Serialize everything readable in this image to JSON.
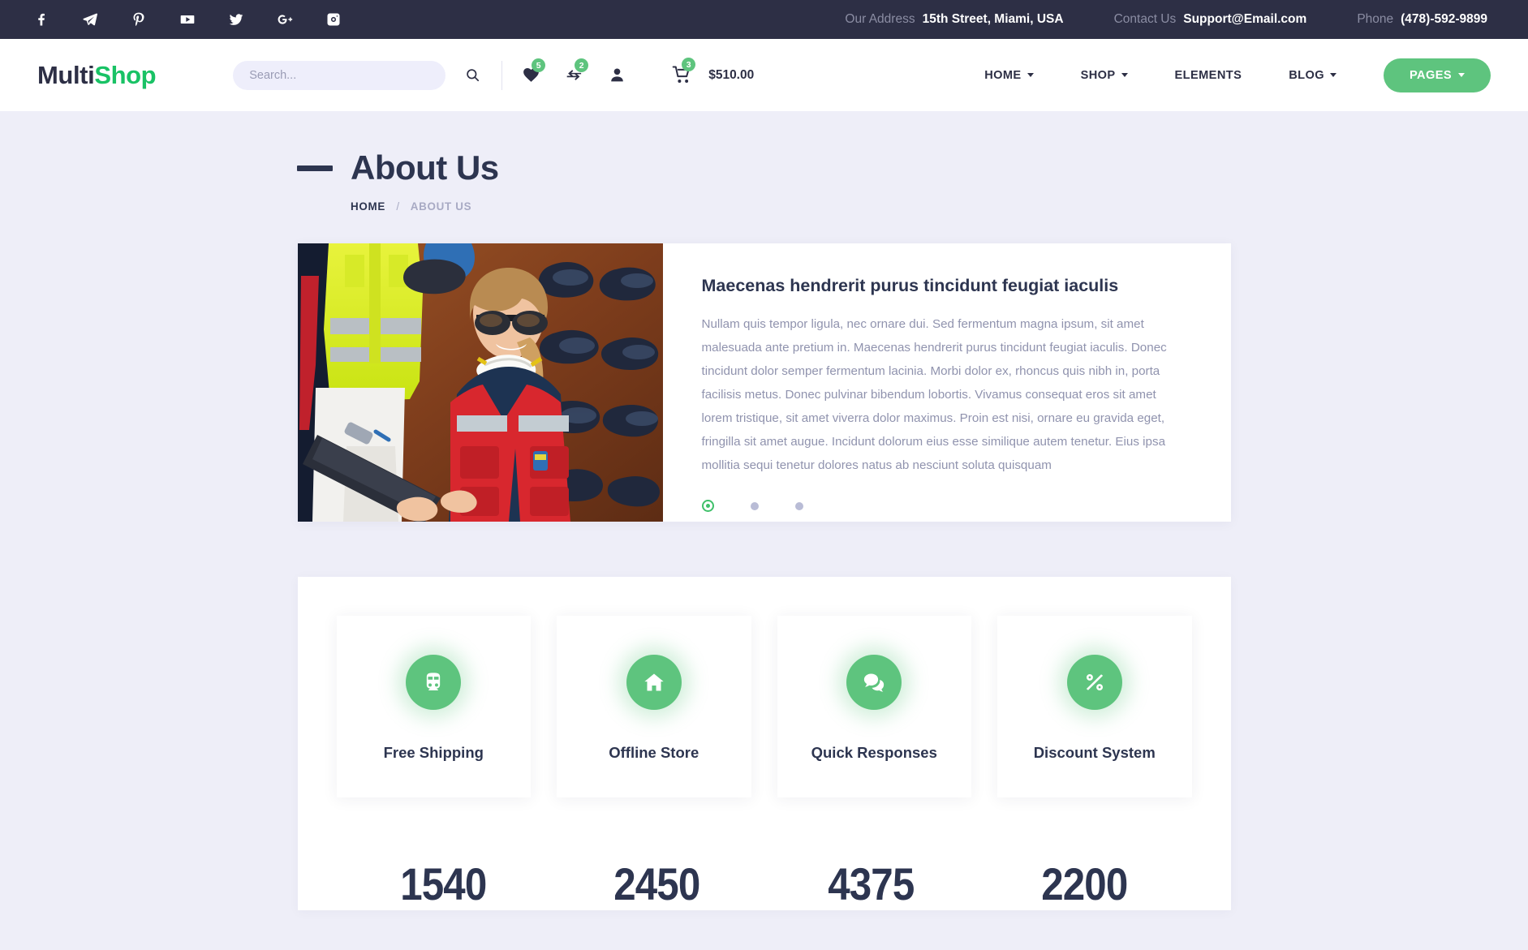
{
  "topbar": {
    "social": [
      {
        "name": "facebook-icon",
        "label": "Facebook"
      },
      {
        "name": "telegram-icon",
        "label": "Telegram"
      },
      {
        "name": "pinterest-icon",
        "label": "Pinterest"
      },
      {
        "name": "youtube-icon",
        "label": "YouTube"
      },
      {
        "name": "twitter-icon",
        "label": "Twitter"
      },
      {
        "name": "google-plus-icon",
        "label": "Google Plus"
      },
      {
        "name": "instagram-icon",
        "label": "Instagram"
      }
    ],
    "address_label": "Our Address",
    "address_value": "15th Street, Miami, USA",
    "contact_label": "Contact Us",
    "contact_value": "Support@Email.com",
    "phone_label": "Phone",
    "phone_value": "(478)-592-9899"
  },
  "header": {
    "logo_first": "Multi",
    "logo_second": "Shop",
    "search_placeholder": "Search...",
    "search_value": "",
    "wishlist_count": "5",
    "compare_count": "2",
    "cart_count": "3",
    "cart_total": "$510.00",
    "nav": [
      {
        "label": "HOME",
        "has_caret": true
      },
      {
        "label": "SHOP",
        "has_caret": true
      },
      {
        "label": "ELEMENTS",
        "has_caret": false
      },
      {
        "label": "BLOG",
        "has_caret": true
      }
    ],
    "pages_button": "PAGES"
  },
  "banner": {
    "title": "About Us",
    "breadcrumb_home": "HOME",
    "breadcrumb_sep": "/",
    "breadcrumb_current": "ABOUT US"
  },
  "about": {
    "heading": "Maecenas hendrerit purus tincidunt feugiat iaculis",
    "paragraph": "Nullam quis tempor ligula, nec ornare dui. Sed fermentum magna ipsum, sit amet malesuada ante pretium in. Maecenas hendrerit purus tincidunt feugiat iaculis. Donec tincidunt dolor semper fermentum lacinia. Morbi dolor ex, rhoncus quis nibh in, porta facilisis metus. Donec pulvinar bibendum lobortis. Vivamus consequat eros sit amet lorem tristique, sit amet viverra dolor maximus. Proin est nisi, ornare eu gravida eget, fringilla sit amet augue. Incidunt dolorum eius esse similique autem tenetur. Eius ipsa mollitia sequi tenetur dolores natus ab nesciunt soluta quisquam",
    "image_alt": "Worker in red safety vest and sunglasses holding a clipboard in a workwear shop",
    "slides": [
      {
        "active": true
      },
      {
        "active": false
      },
      {
        "active": false
      }
    ]
  },
  "features": [
    {
      "icon": "train-icon",
      "title": "Free Shipping"
    },
    {
      "icon": "home-icon",
      "title": "Offline Store"
    },
    {
      "icon": "comments-icon",
      "title": "Quick Responses"
    },
    {
      "icon": "percent-icon",
      "title": "Discount System"
    }
  ],
  "counters": [
    {
      "value": "1540"
    },
    {
      "value": "2450"
    },
    {
      "value": "4375"
    },
    {
      "value": "2200"
    }
  ],
  "colors": {
    "brand_green": "#5ec47e",
    "logo_green": "#19c265",
    "dark_navy": "#2d2f45",
    "title_navy": "#2d3550",
    "page_bg": "#eeeef8",
    "muted_text": "#9093ae"
  }
}
